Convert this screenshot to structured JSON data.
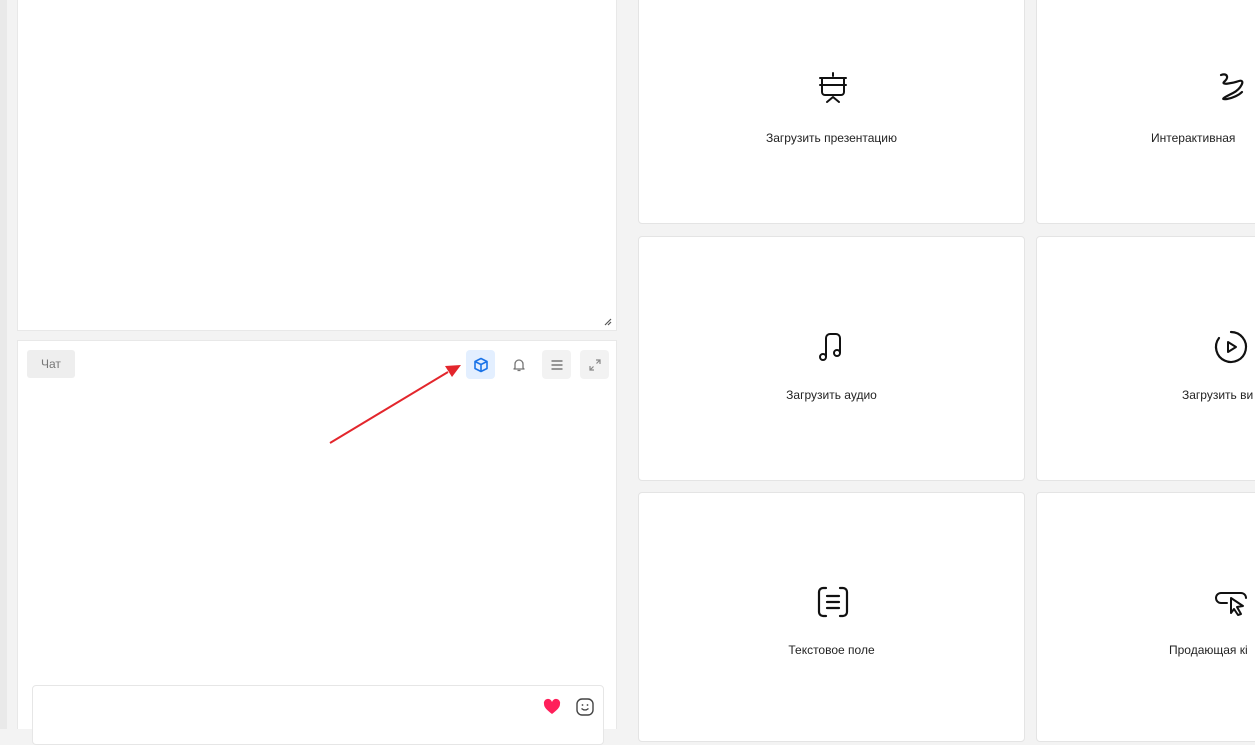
{
  "chat": {
    "tab_label": "Чат",
    "toolbar": [
      {
        "name": "cube-icon",
        "active": true
      },
      {
        "name": "bell-icon",
        "active": false
      },
      {
        "name": "menu-icon",
        "active": false
      },
      {
        "name": "expand-icon",
        "active": false
      }
    ],
    "accent_color": "#1a73e8",
    "heart_color": "#ff1f5a"
  },
  "cards": [
    {
      "label": "Загрузить презентацию",
      "icon": "presentation-icon"
    },
    {
      "label": "Интерактивная",
      "icon": "squiggle-icon"
    },
    {
      "label": "Загрузить аудио",
      "icon": "music-icon"
    },
    {
      "label": "Загрузить ви",
      "icon": "play-icon"
    },
    {
      "label": "Текстовое поле",
      "icon": "text-box-icon"
    },
    {
      "label": "Продающая кі",
      "icon": "pointer-icon"
    }
  ],
  "annotation": {
    "color": "#e3262c"
  }
}
